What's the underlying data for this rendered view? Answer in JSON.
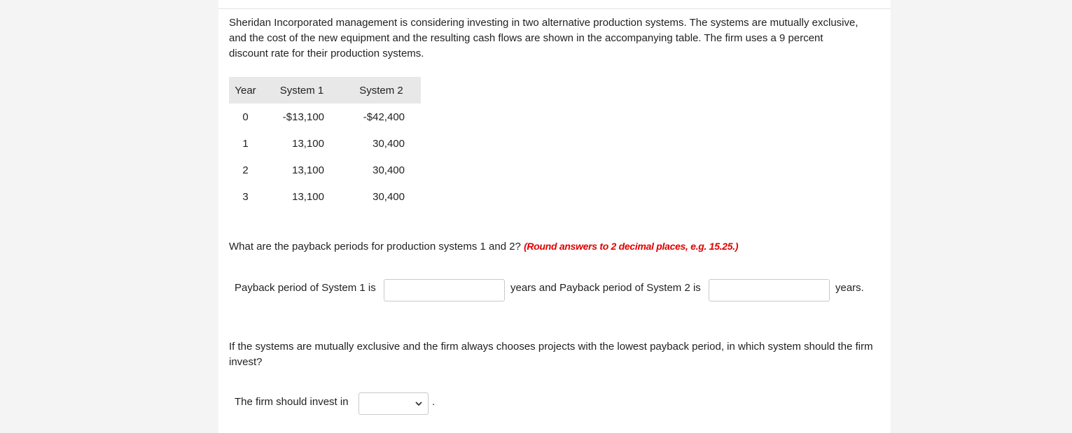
{
  "intro_text": "Sheridan Incorporated management is considering investing in two alternative production systems. The systems are mutually exclusive, and the cost of the new equipment and the resulting cash flows are shown in the accompanying table. The firm uses a 9 percent discount rate for their production systems.",
  "table": {
    "headers": [
      "Year",
      "System 1",
      "System 2"
    ],
    "rows": [
      [
        "0",
        "-$13,100",
        "-$42,400"
      ],
      [
        "1",
        "13,100",
        "30,400"
      ],
      [
        "2",
        "13,100",
        "30,400"
      ],
      [
        "3",
        "13,100",
        "30,400"
      ]
    ]
  },
  "question1": {
    "text": "What are the payback periods for production systems 1 and 2? ",
    "hint": "(Round answers to 2 decimal places, e.g. 15.25.)"
  },
  "payback": {
    "label_system1": "Payback period of System 1 is",
    "system1_value": "",
    "label_system2": "years and Payback period of System 2 is",
    "system2_value": "",
    "suffix": "years."
  },
  "question2": {
    "text": "If the systems are mutually exclusive and the firm always chooses projects with the lowest payback period, in which system should the firm invest?"
  },
  "invest": {
    "label": "The firm should invest in",
    "selected": "",
    "suffix": "."
  },
  "colors": {
    "hint": "#e00000",
    "table_header_bg": "#e8e8e8",
    "page_bg": "#f4f4f4",
    "panel_bg": "#ffffff"
  },
  "icons": {
    "select_arrow": "chevron-down-icon"
  }
}
